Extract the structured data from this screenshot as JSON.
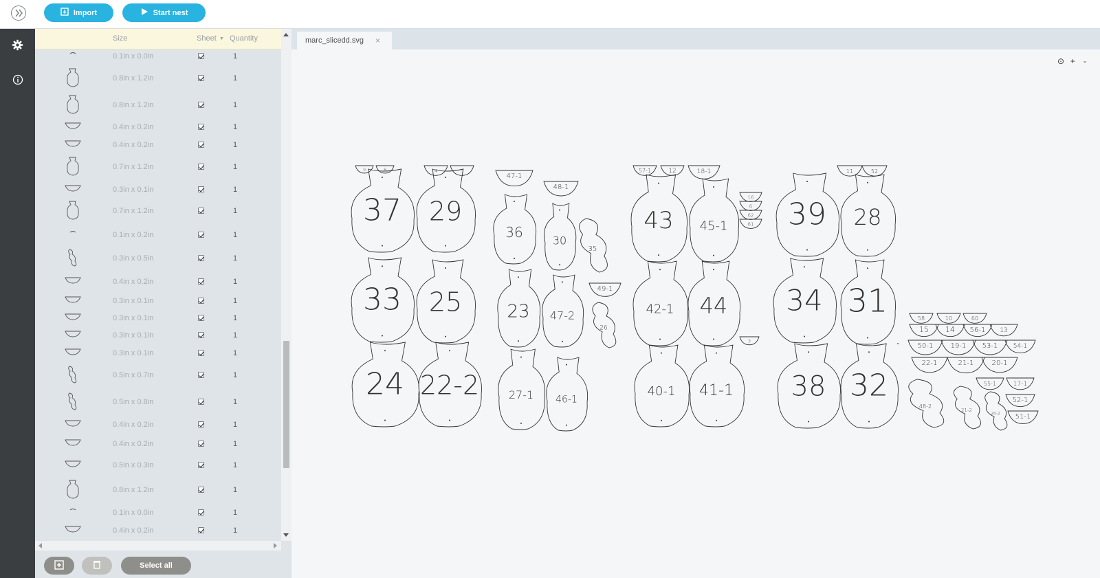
{
  "toolbar": {
    "import_label": "Import",
    "start_label": "Start nest"
  },
  "parts_table": {
    "headers": {
      "size": "Size",
      "sheet": "Sheet",
      "quantity": "Quantity"
    },
    "rows": [
      {
        "size": "0.1in x 0.0in",
        "sheet_checked": true,
        "quantity": "1"
      },
      {
        "size": "0.8in x 1.2in",
        "sheet_checked": true,
        "quantity": "1"
      },
      {
        "size": "0.8in x 1.2in",
        "sheet_checked": true,
        "quantity": "1"
      },
      {
        "size": "0.4in x 0.2in",
        "sheet_checked": true,
        "quantity": "1"
      },
      {
        "size": "0.4in x 0.2in",
        "sheet_checked": true,
        "quantity": "1"
      },
      {
        "size": "0.7in x 1.2in",
        "sheet_checked": true,
        "quantity": "1"
      },
      {
        "size": "0.3in x 0.1in",
        "sheet_checked": true,
        "quantity": "1"
      },
      {
        "size": "0.7in x 1.2in",
        "sheet_checked": true,
        "quantity": "1"
      },
      {
        "size": "0.1in x 0.2in",
        "sheet_checked": true,
        "quantity": "1"
      },
      {
        "size": "0.3in x 0.5in",
        "sheet_checked": true,
        "quantity": "1"
      },
      {
        "size": "0.4in x 0.2in",
        "sheet_checked": true,
        "quantity": "1"
      },
      {
        "size": "0.3in x 0.1in",
        "sheet_checked": true,
        "quantity": "1"
      },
      {
        "size": "0.3in x 0.1in",
        "sheet_checked": true,
        "quantity": "1"
      },
      {
        "size": "0.3in x 0.1in",
        "sheet_checked": true,
        "quantity": "1"
      },
      {
        "size": "0.3in x 0.1in",
        "sheet_checked": true,
        "quantity": "1"
      },
      {
        "size": "0.5in x 0.7in",
        "sheet_checked": true,
        "quantity": "1"
      },
      {
        "size": "0.5in x 0.8in",
        "sheet_checked": true,
        "quantity": "1"
      },
      {
        "size": "0.4in x 0.2in",
        "sheet_checked": true,
        "quantity": "1"
      },
      {
        "size": "0.4in x 0.2in",
        "sheet_checked": true,
        "quantity": "1"
      },
      {
        "size": "0.5in x 0.3in",
        "sheet_checked": true,
        "quantity": "1"
      },
      {
        "size": "0.8in x 1.2in",
        "sheet_checked": true,
        "quantity": "1"
      },
      {
        "size": "0.1in x 0.0in",
        "sheet_checked": true,
        "quantity": "1"
      },
      {
        "size": "0.4in x 0.2in",
        "sheet_checked": true,
        "quantity": "1"
      }
    ]
  },
  "footer": {
    "select_all_label": "Select all"
  },
  "workspace": {
    "tab_name": "marc_slicedd.svg",
    "tab_close": "×",
    "zoom_reset": "⊙",
    "zoom_in": "+",
    "zoom_out": "-"
  },
  "nest_labels": [
    "37",
    "29",
    "36",
    "30",
    "35",
    "33",
    "25",
    "23",
    "47-2",
    "26",
    "24",
    "22-2",
    "27-1",
    "46-1",
    "47-1",
    "48-1",
    "49-1",
    "43",
    "45-1",
    "42-1",
    "44",
    "40-1",
    "41-1",
    "57-1",
    "12",
    "18-1",
    "39",
    "28",
    "34",
    "31",
    "38",
    "32",
    "11",
    "52",
    "58",
    "10",
    "60",
    "15",
    "14",
    "56-1",
    "13",
    "50-1",
    "19-1",
    "53-1",
    "54-1",
    "22-1",
    "21-1",
    "20-1",
    "55-1",
    "17-1",
    "52-1",
    "51-1",
    "48-2",
    "21-2",
    "26-2",
    "16",
    "6",
    "62",
    "61",
    "9",
    "8",
    "4",
    "5",
    "3",
    "2"
  ],
  "colors": {
    "accent": "#28b3e1",
    "rail": "#3b3e41",
    "panel": "#dfe4e9",
    "header": "#fbf6de"
  }
}
